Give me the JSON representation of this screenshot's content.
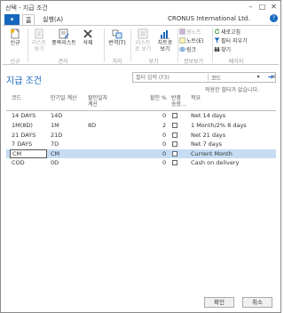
{
  "window": {
    "title": "선택 - 지급 조건",
    "minimize": "–",
    "maximize": "□",
    "close": "✕"
  },
  "ribbon_tabs": {
    "app_button": "▾",
    "home": "홈",
    "actions": "실행(A)"
  },
  "company": "CRONUS International Ltd.",
  "help": "?",
  "ribbon": {
    "new": "신규",
    "group_new": "신규",
    "edit_list": "리스트\n보기",
    "edit_list_line1": "리스트",
    "edit_list_line2": "보기",
    "edit_list2_line1": "리스트",
    "edit_list2_line2": "보기",
    "edit_full": "풍목리스트",
    "delete": "삭제",
    "group_manage": "관리",
    "translate": "번역(T)",
    "group_process": "처리",
    "view_list_line1": "리스트",
    "view_list_line2": "로 보기",
    "view_chart_line1": "차트로",
    "view_chart_line2": "보기",
    "group_view": "보기",
    "onenote": "원노트",
    "notes": "노트(E)",
    "links": "링크",
    "group_show": "정보보기",
    "refresh": "새로고침",
    "clear_filter": "필터 지우기",
    "find": "찾기",
    "group_page": "페이지"
  },
  "page": {
    "title": "지급 조건",
    "filter_placeholder": "필터 입력 (F3)",
    "filter_field": "코드",
    "filter_status": "적용한 필터가 없습니다.",
    "collapse": "∨"
  },
  "table": {
    "headers": {
      "code": "코드",
      "due_calc_line1": "만기일 계산",
      "disc_calc_line1": "할인일자",
      "disc_calc_line2": "계산",
      "disc_pct": "할인 %",
      "calc_pmt_line1": "반품",
      "calc_pmt_line2": "송장...",
      "description": "적요"
    },
    "rows": [
      {
        "code": "14 DAYS",
        "due": "14D",
        "disc_calc": "",
        "disc_pct": "0",
        "description": "Net 14 days"
      },
      {
        "code": "1M(8D)",
        "due": "1M",
        "disc_calc": "8D",
        "disc_pct": "2",
        "description": "1 Month/2% 8 days"
      },
      {
        "code": "21 DAYS",
        "due": "21D",
        "disc_calc": "",
        "disc_pct": "0",
        "description": "Net 21 days"
      },
      {
        "code": "7 DAYS",
        "due": "7D",
        "disc_calc": "",
        "disc_pct": "0",
        "description": "Net 7 days"
      },
      {
        "code": "CM",
        "due": "CM",
        "disc_calc": "",
        "disc_pct": "0",
        "description": "Current Month"
      },
      {
        "code": "COD",
        "due": "0D",
        "disc_calc": "",
        "disc_pct": "0",
        "description": "Cash on delivery"
      }
    ]
  },
  "footer": {
    "ok": "확인",
    "cancel": "취소"
  },
  "colors": {
    "accent": "#1566bd",
    "selected_row": "#c5dcf3"
  }
}
